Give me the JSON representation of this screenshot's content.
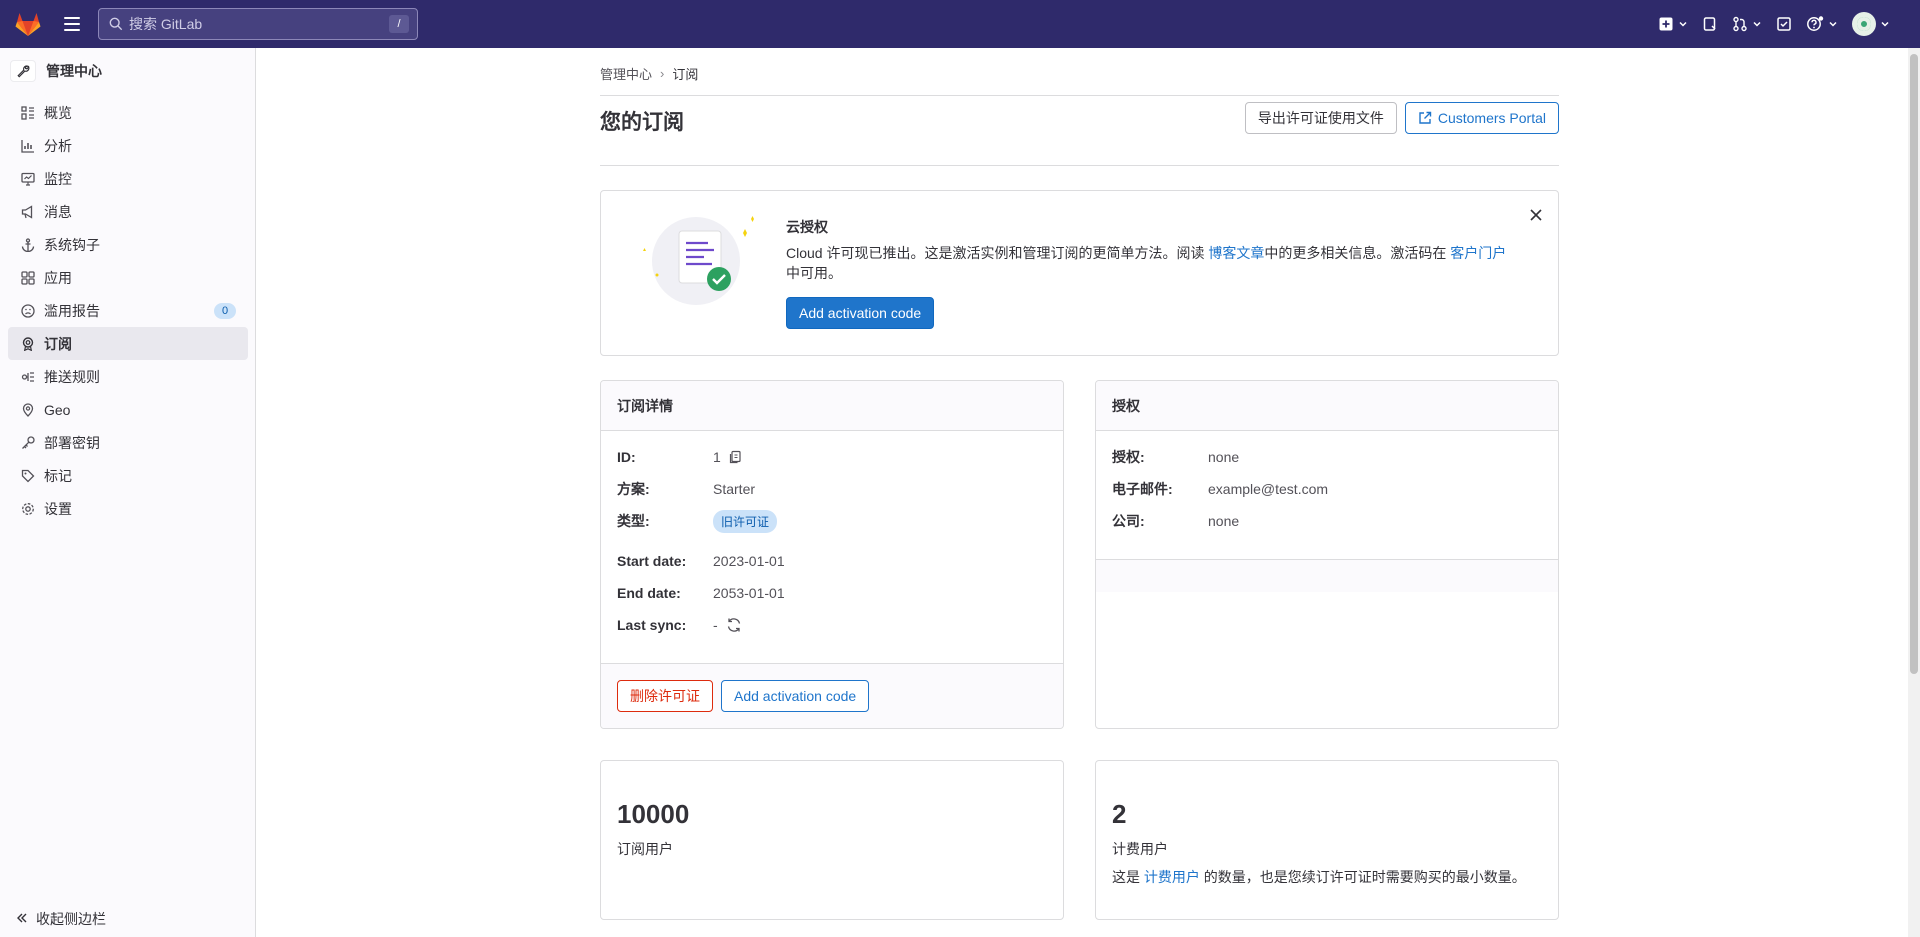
{
  "topbar": {
    "search_placeholder": "搜索 GitLab",
    "search_shortcut": "/"
  },
  "sidebar": {
    "header": "管理中心",
    "items": [
      {
        "label": "概览",
        "icon": "overview-icon"
      },
      {
        "label": "分析",
        "icon": "analytics-icon"
      },
      {
        "label": "监控",
        "icon": "monitor-icon"
      },
      {
        "label": "消息",
        "icon": "megaphone-icon"
      },
      {
        "label": "系统钩子",
        "icon": "anchor-icon"
      },
      {
        "label": "应用",
        "icon": "applications-icon"
      },
      {
        "label": "滥用报告",
        "icon": "abuse-icon",
        "badge": "0"
      },
      {
        "label": "订阅",
        "icon": "subscription-icon",
        "active": true
      },
      {
        "label": "推送规则",
        "icon": "push-rules-icon"
      },
      {
        "label": "Geo",
        "icon": "location-icon"
      },
      {
        "label": "部署密钥",
        "icon": "key-icon"
      },
      {
        "label": "标记",
        "icon": "label-icon"
      },
      {
        "label": "设置",
        "icon": "settings-icon"
      }
    ],
    "collapse_label": "收起侧边栏"
  },
  "breadcrumb": {
    "parent": "管理中心",
    "current": "订阅"
  },
  "page": {
    "title": "您的订阅",
    "export_button": "导出许可证使用文件",
    "portal_button": "Customers Portal"
  },
  "cloud_alert": {
    "title": "云授权",
    "text_before": "Cloud 许可现已推出。这是激活实例和管理订阅的更简单方法。阅读 ",
    "blog_link": "博客文章",
    "text_middle": "中的更多相关信息。激活码在 ",
    "portal_link": "客户门户",
    "text_after": "中可用。",
    "button": "Add activation code"
  },
  "subscription_details": {
    "title": "订阅详情",
    "id_label": "ID:",
    "id_value": "1",
    "plan_label": "方案:",
    "plan_value": "Starter",
    "type_label": "类型:",
    "type_value": "旧许可证",
    "start_label": "Start date:",
    "start_value": "2023-01-01",
    "end_label": "End date:",
    "end_value": "2053-01-01",
    "sync_label": "Last sync:",
    "sync_value": "-",
    "remove_button": "删除许可证",
    "activation_button": "Add activation code"
  },
  "license": {
    "title": "授权",
    "licensee_label": "授权:",
    "licensee_value": "none",
    "email_label": "电子邮件:",
    "email_value": "example@test.com",
    "company_label": "公司:",
    "company_value": "none"
  },
  "stats": {
    "subscribed_users": "10000",
    "subscribed_label": "订阅用户",
    "billable_users": "2",
    "billable_label": "计费用户",
    "billable_desc_before": "这是 ",
    "billable_link": "计费用户",
    "billable_desc_after": " 的数量，也是您续订许可证时需要购买的最小数量。"
  },
  "colors": {
    "topbar": "#2f2a6b",
    "primary": "#1f75cb",
    "danger": "#dd2b0e"
  }
}
